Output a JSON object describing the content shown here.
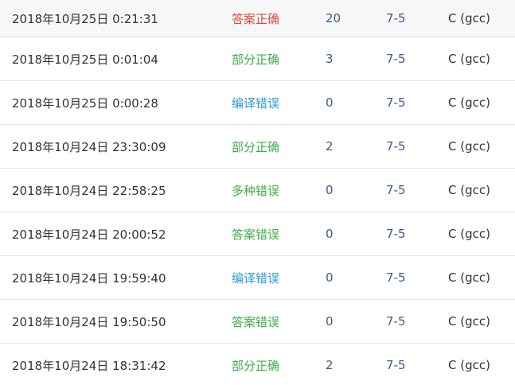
{
  "colors": {
    "red": "#e04a3f",
    "green": "#3fae49",
    "blue": "#2a9bd6",
    "link": "#3a5b8f"
  },
  "rows": [
    {
      "time": "2018年10月25日 0:21:31",
      "status": "答案正确",
      "status_color": "red",
      "score": "20",
      "problem": "7-5",
      "lang": "C (gcc)"
    },
    {
      "time": "2018年10月25日 0:01:04",
      "status": "部分正确",
      "status_color": "green",
      "score": "3",
      "problem": "7-5",
      "lang": "C (gcc)"
    },
    {
      "time": "2018年10月25日 0:00:28",
      "status": "编译错误",
      "status_color": "blue",
      "score": "0",
      "problem": "7-5",
      "lang": "C (gcc)"
    },
    {
      "time": "2018年10月24日 23:30:09",
      "status": "部分正确",
      "status_color": "green",
      "score": "2",
      "problem": "7-5",
      "lang": "C (gcc)"
    },
    {
      "time": "2018年10月24日 22:58:25",
      "status": "多种错误",
      "status_color": "green",
      "score": "0",
      "problem": "7-5",
      "lang": "C (gcc)"
    },
    {
      "time": "2018年10月24日 20:00:52",
      "status": "答案错误",
      "status_color": "green",
      "score": "0",
      "problem": "7-5",
      "lang": "C (gcc)"
    },
    {
      "time": "2018年10月24日 19:59:40",
      "status": "编译错误",
      "status_color": "blue",
      "score": "0",
      "problem": "7-5",
      "lang": "C (gcc)"
    },
    {
      "time": "2018年10月24日 19:50:50",
      "status": "答案错误",
      "status_color": "green",
      "score": "0",
      "problem": "7-5",
      "lang": "C (gcc)"
    },
    {
      "time": "2018年10月24日 18:31:42",
      "status": "部分正确",
      "status_color": "green",
      "score": "2",
      "problem": "7-5",
      "lang": "C (gcc)"
    }
  ]
}
